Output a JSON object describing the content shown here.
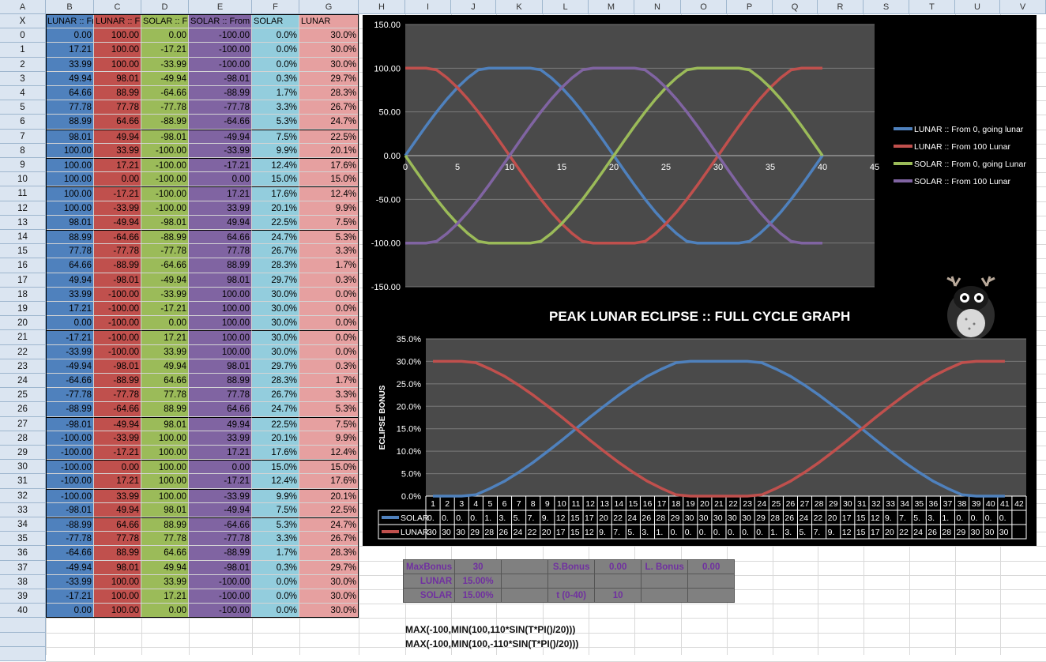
{
  "spreadsheet": {
    "columns": [
      "A",
      "B",
      "C",
      "D",
      "E",
      "F",
      "G",
      "H",
      "I",
      "J",
      "K",
      "L",
      "M",
      "N",
      "O",
      "P",
      "Q",
      "R",
      "S",
      "T",
      "U",
      "V"
    ],
    "headers": {
      "A": "X",
      "B": "LUNAR :: Fr",
      "C": "LUNAR :: Fr",
      "D": "SOLAR :: Fr",
      "E": "SOLAR :: From",
      "F": "SOLAR",
      "G": "LUNAR"
    },
    "row_labels": [
      "0",
      "1",
      "2",
      "3",
      "4",
      "5",
      "6",
      "7",
      "8",
      "9",
      "10",
      "11",
      "12",
      "13",
      "14",
      "15",
      "16",
      "17",
      "18",
      "19",
      "20",
      "21",
      "22",
      "23",
      "24",
      "25",
      "26",
      "27",
      "28",
      "29",
      "30",
      "31",
      "32",
      "33",
      "34",
      "35",
      "36",
      "37",
      "38",
      "39",
      "40"
    ],
    "col_b": [
      "0.00",
      "17.21",
      "33.99",
      "49.94",
      "64.66",
      "77.78",
      "88.99",
      "98.01",
      "100.00",
      "100.00",
      "100.00",
      "100.00",
      "100.00",
      "98.01",
      "88.99",
      "77.78",
      "64.66",
      "49.94",
      "33.99",
      "17.21",
      "0.00",
      "-17.21",
      "-33.99",
      "-49.94",
      "-64.66",
      "-77.78",
      "-88.99",
      "-98.01",
      "-100.00",
      "-100.00",
      "-100.00",
      "-100.00",
      "-100.00",
      "-98.01",
      "-88.99",
      "-77.78",
      "-64.66",
      "-49.94",
      "-33.99",
      "-17.21",
      "0.00"
    ],
    "col_c": [
      "100.00",
      "100.00",
      "100.00",
      "98.01",
      "88.99",
      "77.78",
      "64.66",
      "49.94",
      "33.99",
      "17.21",
      "0.00",
      "-17.21",
      "-33.99",
      "-49.94",
      "-64.66",
      "-77.78",
      "-88.99",
      "-98.01",
      "-100.00",
      "-100.00",
      "-100.00",
      "-100.00",
      "-100.00",
      "-98.01",
      "-88.99",
      "-77.78",
      "-64.66",
      "-49.94",
      "-33.99",
      "-17.21",
      "0.00",
      "17.21",
      "33.99",
      "49.94",
      "64.66",
      "77.78",
      "88.99",
      "98.01",
      "100.00",
      "100.00",
      "100.00"
    ],
    "col_d": [
      "0.00",
      "-17.21",
      "-33.99",
      "-49.94",
      "-64.66",
      "-77.78",
      "-88.99",
      "-98.01",
      "-100.00",
      "-100.00",
      "-100.00",
      "-100.00",
      "-100.00",
      "-98.01",
      "-88.99",
      "-77.78",
      "-64.66",
      "-49.94",
      "-33.99",
      "-17.21",
      "0.00",
      "17.21",
      "33.99",
      "49.94",
      "64.66",
      "77.78",
      "88.99",
      "98.01",
      "100.00",
      "100.00",
      "100.00",
      "100.00",
      "100.00",
      "98.01",
      "88.99",
      "77.78",
      "64.66",
      "49.94",
      "33.99",
      "17.21",
      "0.00"
    ],
    "col_e": [
      "-100.00",
      "-100.00",
      "-100.00",
      "-98.01",
      "-88.99",
      "-77.78",
      "-64.66",
      "-49.94",
      "-33.99",
      "-17.21",
      "0.00",
      "17.21",
      "33.99",
      "49.94",
      "64.66",
      "77.78",
      "88.99",
      "98.01",
      "100.00",
      "100.00",
      "100.00",
      "100.00",
      "100.00",
      "98.01",
      "88.99",
      "77.78",
      "64.66",
      "49.94",
      "33.99",
      "17.21",
      "0.00",
      "-17.21",
      "-33.99",
      "-49.94",
      "-64.66",
      "-77.78",
      "-88.99",
      "-98.01",
      "-100.00",
      "-100.00",
      "-100.00"
    ],
    "col_f": [
      "0.0%",
      "0.0%",
      "0.0%",
      "0.3%",
      "1.7%",
      "3.3%",
      "5.3%",
      "7.5%",
      "9.9%",
      "12.4%",
      "15.0%",
      "17.6%",
      "20.1%",
      "22.5%",
      "24.7%",
      "26.7%",
      "28.3%",
      "29.7%",
      "30.0%",
      "30.0%",
      "30.0%",
      "30.0%",
      "30.0%",
      "29.7%",
      "28.3%",
      "26.7%",
      "24.7%",
      "22.5%",
      "20.1%",
      "17.6%",
      "15.0%",
      "12.4%",
      "9.9%",
      "7.5%",
      "5.3%",
      "3.3%",
      "1.7%",
      "0.3%",
      "0.0%",
      "0.0%",
      "0.0%"
    ],
    "col_g": [
      "30.0%",
      "30.0%",
      "30.0%",
      "29.7%",
      "28.3%",
      "26.7%",
      "24.7%",
      "22.5%",
      "20.1%",
      "17.6%",
      "15.0%",
      "12.4%",
      "9.9%",
      "7.5%",
      "5.3%",
      "3.3%",
      "1.7%",
      "0.3%",
      "0.0%",
      "0.0%",
      "0.0%",
      "0.0%",
      "0.0%",
      "0.3%",
      "1.7%",
      "3.3%",
      "5.3%",
      "7.5%",
      "9.9%",
      "12.4%",
      "15.0%",
      "17.6%",
      "20.1%",
      "22.5%",
      "24.7%",
      "26.7%",
      "28.3%",
      "29.7%",
      "30.0%",
      "30.0%",
      "30.0%"
    ],
    "col_colors": {
      "B": "#4f81bd",
      "C": "#c0504d",
      "D": "#9bbb59",
      "E": "#8064a2",
      "F": "#93cddd",
      "G": "#e6a0a0"
    }
  },
  "chart_data": [
    {
      "type": "line",
      "x": [
        0,
        1,
        2,
        3,
        4,
        5,
        6,
        7,
        8,
        9,
        10,
        11,
        12,
        13,
        14,
        15,
        16,
        17,
        18,
        19,
        20,
        21,
        22,
        23,
        24,
        25,
        26,
        27,
        28,
        29,
        30,
        31,
        32,
        33,
        34,
        35,
        36,
        37,
        38,
        39,
        40
      ],
      "xlim": [
        0,
        45
      ],
      "xticks": [
        "0",
        "5",
        "10",
        "15",
        "20",
        "25",
        "30",
        "35",
        "40",
        "45"
      ],
      "ylim": [
        -150,
        150
      ],
      "yticks": [
        "150.00",
        "100.00",
        "50.00",
        "0.00",
        "-50.00",
        "-100.00",
        "-150.00"
      ],
      "grid": true,
      "legend_position": "right",
      "series": [
        {
          "name": "LUNAR :: From 0, going lunar",
          "color": "#4f81bd",
          "values": [
            0,
            17.21,
            33.99,
            49.94,
            64.66,
            77.78,
            88.99,
            98.01,
            100,
            100,
            100,
            100,
            100,
            98.01,
            88.99,
            77.78,
            64.66,
            49.94,
            33.99,
            17.21,
            0,
            -17.21,
            -33.99,
            -49.94,
            -64.66,
            -77.78,
            -88.99,
            -98.01,
            -100,
            -100,
            -100,
            -100,
            -100,
            -98.01,
            -88.99,
            -77.78,
            -64.66,
            -49.94,
            -33.99,
            -17.21,
            0
          ]
        },
        {
          "name": "LUNAR :: From 100 Lunar",
          "color": "#c0504d",
          "values": [
            100,
            100,
            100,
            98.01,
            88.99,
            77.78,
            64.66,
            49.94,
            33.99,
            17.21,
            0,
            -17.21,
            -33.99,
            -49.94,
            -64.66,
            -77.78,
            -88.99,
            -98.01,
            -100,
            -100,
            -100,
            -100,
            -100,
            -98.01,
            -88.99,
            -77.78,
            -64.66,
            -49.94,
            -33.99,
            -17.21,
            0,
            17.21,
            33.99,
            49.94,
            64.66,
            77.78,
            88.99,
            98.01,
            100,
            100,
            100
          ]
        },
        {
          "name": "SOLAR :: From 0, going Lunar",
          "color": "#9bbb59",
          "values": [
            0,
            -17.21,
            -33.99,
            -49.94,
            -64.66,
            -77.78,
            -88.99,
            -98.01,
            -100,
            -100,
            -100,
            -100,
            -100,
            -98.01,
            -88.99,
            -77.78,
            -64.66,
            -49.94,
            -33.99,
            -17.21,
            0,
            17.21,
            33.99,
            49.94,
            64.66,
            77.78,
            88.99,
            98.01,
            100,
            100,
            100,
            100,
            100,
            98.01,
            88.99,
            77.78,
            64.66,
            49.94,
            33.99,
            17.21,
            0
          ]
        },
        {
          "name": "SOLAR :: From 100 Lunar",
          "color": "#8064a2",
          "values": [
            -100,
            -100,
            -100,
            -98.01,
            -88.99,
            -77.78,
            -64.66,
            -49.94,
            -33.99,
            -17.21,
            0,
            17.21,
            33.99,
            49.94,
            64.66,
            77.78,
            88.99,
            98.01,
            100,
            100,
            100,
            100,
            100,
            98.01,
            88.99,
            77.78,
            64.66,
            49.94,
            33.99,
            17.21,
            0,
            -17.21,
            -33.99,
            -49.94,
            -64.66,
            -77.78,
            -88.99,
            -98.01,
            -100,
            -100,
            -100
          ]
        }
      ]
    },
    {
      "type": "line",
      "title": "PEAK LUNAR ECLIPSE :: FULL CYCLE GRAPH",
      "ylabel": "ECLIPSE BONUS",
      "ylim": [
        0,
        35
      ],
      "yticks": [
        "35.0%",
        "30.0%",
        "25.0%",
        "20.0%",
        "15.0%",
        "10.0%",
        "5.0%",
        "0.0%"
      ],
      "categories": [
        "1",
        "2",
        "3",
        "4",
        "5",
        "6",
        "7",
        "8",
        "9",
        "10",
        "11",
        "12",
        "13",
        "14",
        "15",
        "16",
        "17",
        "18",
        "19",
        "20",
        "21",
        "22",
        "23",
        "24",
        "25",
        "26",
        "27",
        "28",
        "29",
        "30",
        "31",
        "32",
        "33",
        "34",
        "35",
        "36",
        "37",
        "38",
        "39",
        "40",
        "41",
        "42"
      ],
      "grid": true,
      "series": [
        {
          "name": "SOLAR",
          "color": "#4f81bd",
          "values": [
            0,
            0,
            0,
            0.3,
            1.7,
            3.3,
            5.3,
            7.5,
            9.9,
            12.4,
            15,
            17.6,
            20.1,
            22.5,
            24.7,
            26.7,
            28.3,
            29.7,
            30,
            30,
            30,
            30,
            30,
            29.7,
            28.3,
            26.7,
            24.7,
            22.5,
            20.1,
            17.6,
            15,
            12.4,
            9.9,
            7.5,
            5.3,
            3.3,
            1.7,
            0.3,
            0,
            0,
            0
          ],
          "table_row": [
            "0.",
            "0.",
            "0.",
            "0.",
            "1.",
            "3.",
            "5.",
            "7.",
            "9.",
            "12",
            "15",
            "17",
            "20",
            "22",
            "24",
            "26",
            "28",
            "29",
            "30",
            "30",
            "30",
            "30",
            "30",
            "29",
            "28",
            "26",
            "24",
            "22",
            "20",
            "17",
            "15",
            "12",
            "9.",
            "7.",
            "5.",
            "3.",
            "1.",
            "0.",
            "0.",
            "0.",
            "0."
          ]
        },
        {
          "name": "LUNAR",
          "color": "#c0504d",
          "values": [
            30,
            30,
            30,
            29.7,
            28.3,
            26.7,
            24.7,
            22.5,
            20.1,
            17.6,
            15,
            12.4,
            9.9,
            7.5,
            5.3,
            3.3,
            1.7,
            0.3,
            0,
            0,
            0,
            0,
            0,
            0.3,
            1.7,
            3.3,
            5.3,
            7.5,
            9.9,
            12.4,
            15,
            17.6,
            20.1,
            22.5,
            24.7,
            26.7,
            28.3,
            29.7,
            30,
            30,
            30
          ],
          "table_row": [
            "30",
            "30",
            "30",
            "29",
            "28",
            "26",
            "24",
            "22",
            "20",
            "17",
            "15",
            "12",
            "9.",
            "7.",
            "5.",
            "3.",
            "1.",
            "0.",
            "0.",
            "0.",
            "0.",
            "0.",
            "0.",
            "0.",
            "1.",
            "3.",
            "5.",
            "7.",
            "9.",
            "12",
            "15",
            "17",
            "20",
            "22",
            "24",
            "26",
            "28",
            "29",
            "30",
            "30",
            "30"
          ]
        }
      ]
    }
  ],
  "values_table": {
    "rows": [
      [
        "MaxBonus",
        "30",
        "",
        "S.Bonus",
        "0.00",
        "L. Bonus",
        "0.00"
      ],
      [
        "LUNAR",
        "15.00%",
        "",
        "",
        "",
        "",
        ""
      ],
      [
        "SOLAR",
        "15.00%",
        "",
        "t (0-40)",
        "10",
        "",
        ""
      ]
    ]
  },
  "formulas": [
    "MAX(-100,MIN(100,110*SIN(T*PI()/20)))",
    "MAX(-100,MIN(100,-110*SIN(T*PI()/20)))"
  ]
}
